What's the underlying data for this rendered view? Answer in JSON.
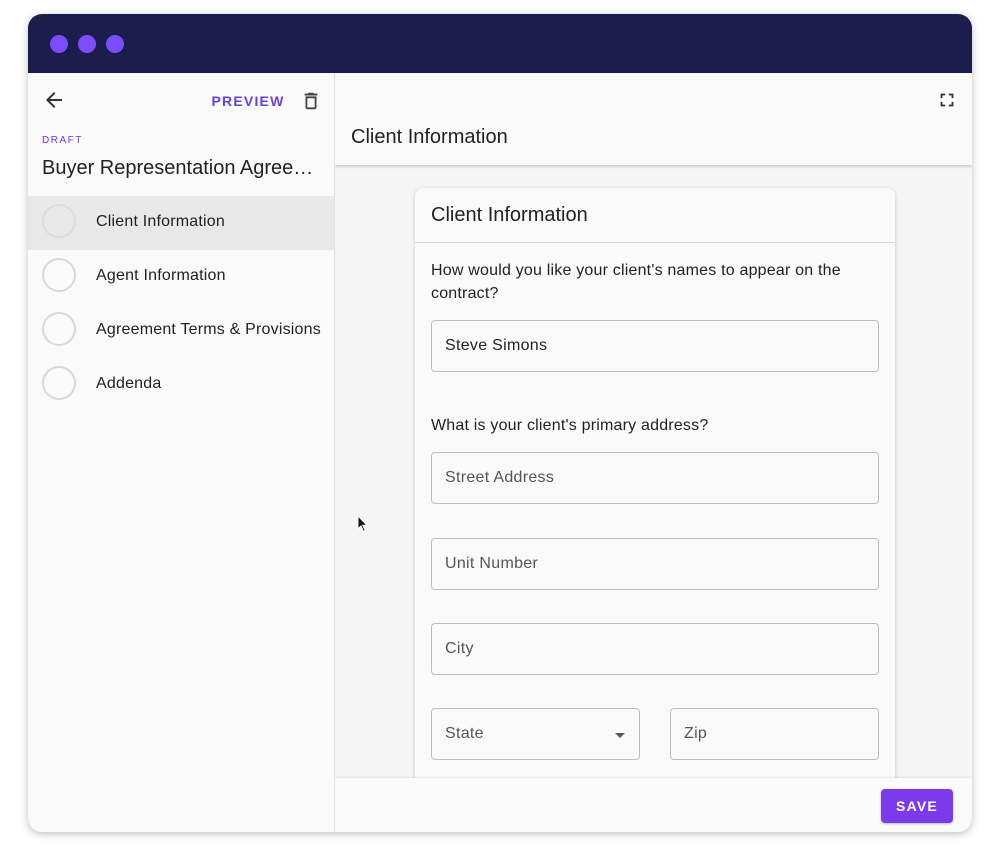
{
  "window": {
    "accent": "#7c4dff",
    "titlebar_color": "#1c1c4d"
  },
  "sidebar": {
    "back_icon": "arrow-left-icon",
    "preview_label": "PREVIEW",
    "delete_icon": "trash-icon",
    "status": "DRAFT",
    "document_title": "Buyer Representation Agreement",
    "steps": [
      {
        "label": "Client Information",
        "active": true
      },
      {
        "label": "Agent Information",
        "active": false
      },
      {
        "label": "Agreement Terms & Provisions",
        "active": false
      },
      {
        "label": "Addenda",
        "active": false
      }
    ]
  },
  "main": {
    "title": "Client Information",
    "fullscreen_icon": "fullscreen-icon"
  },
  "card": {
    "title": "Client Information",
    "q1": "How would you like your client's names to appear on the contract?",
    "client_names_value": "Steve Simons",
    "q2": "What is your client's primary address?",
    "street_placeholder": "Street Address",
    "unit_placeholder": "Unit Number",
    "city_placeholder": "City",
    "state_label": "State",
    "zip_placeholder": "Zip"
  },
  "footer": {
    "save_label": "SAVE",
    "save_color": "#7c3aed"
  }
}
